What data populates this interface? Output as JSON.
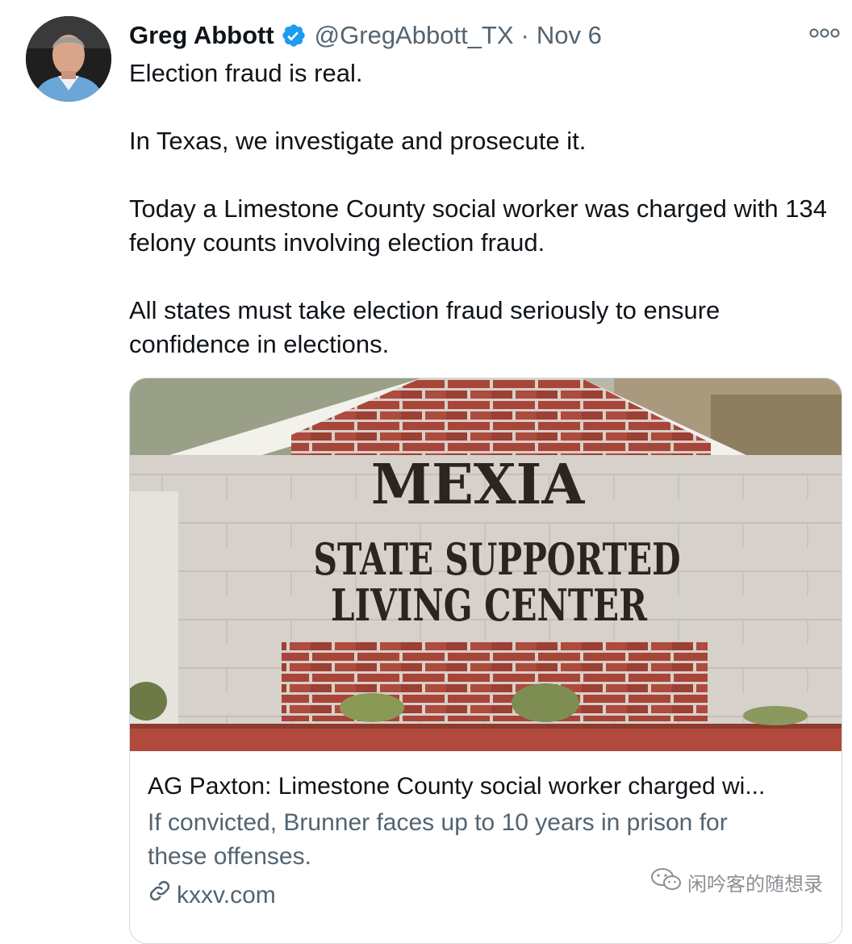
{
  "tweet": {
    "author": {
      "name": "Greg Abbott",
      "handle": "@GregAbbott_TX",
      "verified_icon": "verified-badge-icon"
    },
    "separator": "·",
    "date": "Nov 6",
    "more_icon": "more-options-icon",
    "paragraphs": [
      "Election fraud is real.",
      "In Texas, we investigate and prosecute it.",
      "Today a Limestone County social worker was charged with 134 felony counts involving election fraud.",
      "All states must take election fraud seriously to ensure confidence in elections."
    ]
  },
  "card": {
    "sign_line1": "MEXIA",
    "sign_line2": "STATE SUPPORTED",
    "sign_line3": "LIVING CENTER",
    "title": "AG Paxton: Limestone County social worker charged wi...",
    "description": "If convicted, Brunner faces up to 10 years in prison for these offenses.",
    "domain": "kxxv.com",
    "link_icon": "link-icon"
  },
  "watermark": {
    "text": "闲吟客的随想录",
    "icon": "wechat-icon"
  },
  "colors": {
    "text_primary": "#0f1419",
    "text_secondary": "#536471",
    "verified_blue": "#1d9bf0",
    "border": "#cfd9de"
  }
}
